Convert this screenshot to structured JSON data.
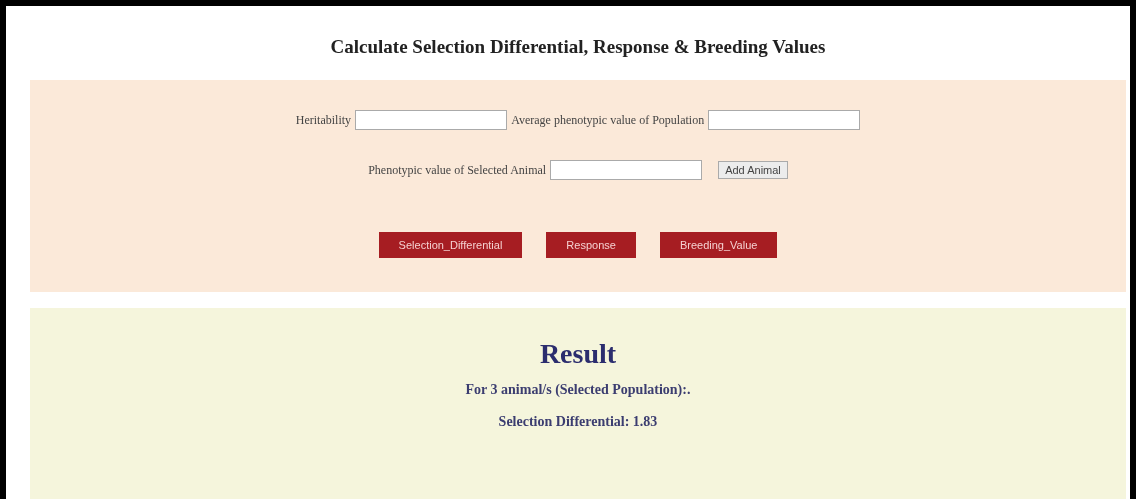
{
  "title": "Calculate Selection Differential, Response & Breeding Values",
  "form": {
    "rows": [
      [
        {
          "label": "Heritability"
        },
        {
          "label": "Average phenotypic value of Population"
        }
      ],
      [
        {
          "label": "Phenotypic value of Selected Animal"
        }
      ]
    ],
    "add_button": "Add Animal",
    "actions": [
      "Selection_Differential",
      "Response",
      "Breeding_Value"
    ]
  },
  "result": {
    "heading": "Result",
    "lines": [
      "For 3 animal/s (Selected Population):.",
      "Selection Differential: 1.83"
    ]
  }
}
